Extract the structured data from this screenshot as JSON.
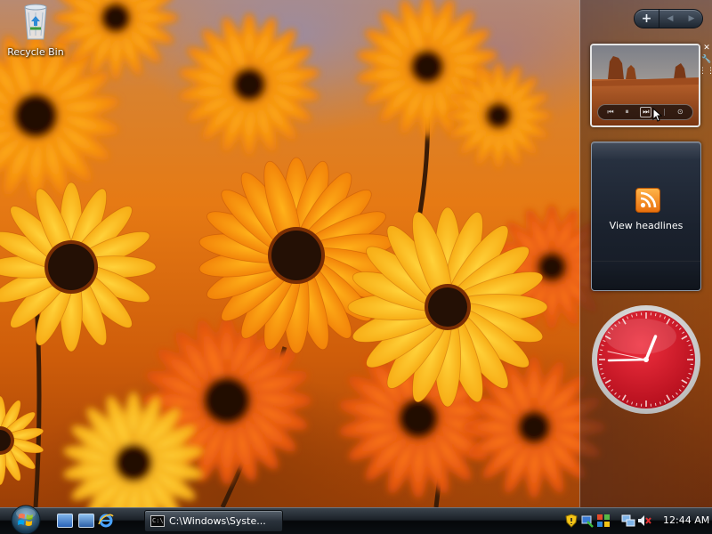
{
  "desktop": {
    "icons": [
      {
        "label": "Recycle Bin",
        "icon": "recycle-bin-icon"
      }
    ]
  },
  "sidebar": {
    "controls": {
      "add": "+",
      "prev": "◀",
      "next": "▶"
    },
    "slideshow": {
      "controls": [
        "⏮",
        "⏸",
        "⏭",
        "⊙"
      ]
    },
    "feeds": {
      "icon": "rss-icon",
      "label": "View headlines"
    },
    "clock": {
      "hour": 12,
      "minute": 44,
      "second": 47,
      "face_color": "#d8192b"
    }
  },
  "taskbar": {
    "start": "windows-start-orb",
    "quick_launch": [
      "show-desktop-icon",
      "switch-windows-icon",
      "internet-explorer-icon"
    ],
    "tasks": [
      {
        "label": "C:\\Windows\\Syste...",
        "icon": "command-prompt-icon",
        "icon_text": "C:\\"
      }
    ],
    "tray_icons": [
      "security-shield-icon",
      "network-icon",
      "windows-update-icon",
      "network-connection-icon",
      "volume-muted-icon"
    ],
    "time": "12:44 AM"
  }
}
